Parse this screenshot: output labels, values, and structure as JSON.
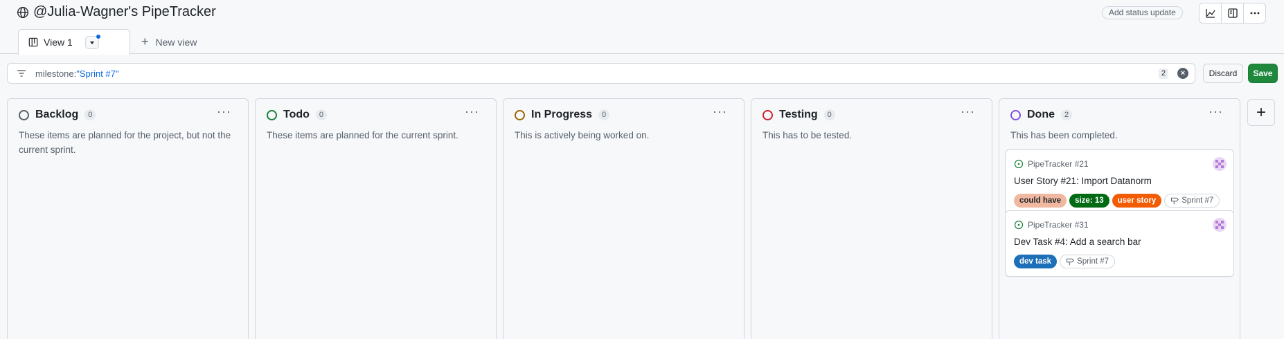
{
  "header": {
    "title": "@Julia-Wagner's PipeTracker",
    "status_update": "Add status update",
    "icons": [
      "chart-icon",
      "side-panel-icon",
      "kebab-menu-icon"
    ]
  },
  "tabs": {
    "active": "View 1",
    "new_view": "New view"
  },
  "filter": {
    "prefix": "milestone:",
    "value": "\"Sprint #7\"",
    "count": "2",
    "discard": "Discard",
    "save": "Save"
  },
  "columns": [
    {
      "name": "Backlog",
      "count": "0",
      "color": "#57606a",
      "description": "These items are planned for the project, but not the current sprint."
    },
    {
      "name": "Todo",
      "count": "0",
      "color": "#1a7f37",
      "description": "These items are planned for the current sprint."
    },
    {
      "name": "In Progress",
      "count": "0",
      "color": "#9a6700",
      "description": "This is actively being worked on."
    },
    {
      "name": "Testing",
      "count": "0",
      "color": "#cf222e",
      "description": "This has to be tested."
    },
    {
      "name": "Done",
      "count": "2",
      "color": "#8250df",
      "description": "This has been completed."
    }
  ],
  "cards": [
    {
      "repo": "PipeTracker #21",
      "title": "User Story #21: Import Datanorm",
      "labels": [
        {
          "text": "could have",
          "bg": "#f0b8a0",
          "fg": "#1f2328"
        },
        {
          "text": "size: 13",
          "bg": "#006b14",
          "fg": "#ffffff"
        },
        {
          "text": "user story",
          "bg": "#f25c05",
          "fg": "#ffffff"
        }
      ],
      "milestone": "Sprint #7"
    },
    {
      "repo": "PipeTracker #31",
      "title": "Dev Task #4: Add a search bar",
      "labels": [
        {
          "text": "dev task",
          "bg": "#1d6fb8",
          "fg": "#ffffff"
        }
      ],
      "milestone": "Sprint #7"
    }
  ],
  "add_column": "+"
}
